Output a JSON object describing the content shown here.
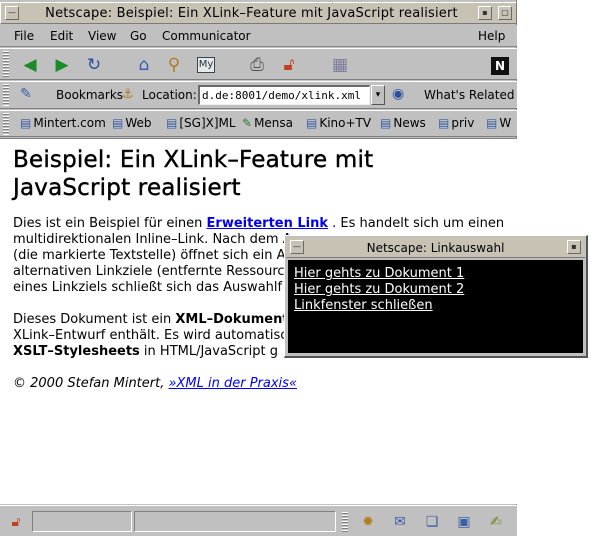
{
  "window": {
    "title": "Netscape: Beispiel: Ein XLink–Feature mit JavaScript realisiert"
  },
  "menu": {
    "file": "File",
    "edit": "Edit",
    "view": "View",
    "go": "Go",
    "communicator": "Communicator",
    "help": "Help"
  },
  "toolbar": {
    "icons": [
      "back-icon",
      "forward-icon",
      "reload-icon",
      "home-icon",
      "search-icon",
      "my-netscape-icon",
      "print-icon",
      "security-icon",
      "stop-icon",
      "netscape-logo"
    ]
  },
  "location": {
    "bookmarks_label": "Bookmarks",
    "location_label": "Location:",
    "url": "d.de:8001/demo/xlink.xml",
    "whats_related": "What's Related"
  },
  "personal_toolbar": {
    "items": [
      "Mintert.com",
      "Web",
      "[SG]X]ML",
      "Mensa",
      "Kino+TV",
      "News",
      "priv",
      "W"
    ]
  },
  "page": {
    "heading": "Beispiel: Ein XLink–Feature mit JavaScript realisiert",
    "p1": {
      "before_link": "Dies ist ein Beispiel für einen ",
      "link": "Erweiterten Link",
      "after_link": " . Es handelt sich um einen",
      "line2": "multidirektionalen Inline–Link. Nach dem A",
      "line3": "(die markierte Textstelle) öffnet sich ein Au",
      "line4": "alternativen Linkziele (entfernte Ressource",
      "line5": "eines Linkziels schließt sich das Auswahlf"
    },
    "p2": {
      "before_bold": "Dieses Dokument ist ein ",
      "bold": "XML–Dokument",
      "line2": "XLink–Entwurf enthält. Es wird automatisch",
      "line3_bold": "XSLT–Stylesheets",
      "line3_rest": " in HTML/JavaScript g"
    },
    "footer": {
      "copyright": "© 2000 Stefan Mintert, ",
      "book_link": "»XML in der Praxis«"
    }
  },
  "popup": {
    "title": "Netscape: Linkauswahl",
    "links": [
      "Hier gehts zu Dokument 1",
      "Hier gehts zu Dokument 2",
      "Linkfenster schließen"
    ]
  }
}
